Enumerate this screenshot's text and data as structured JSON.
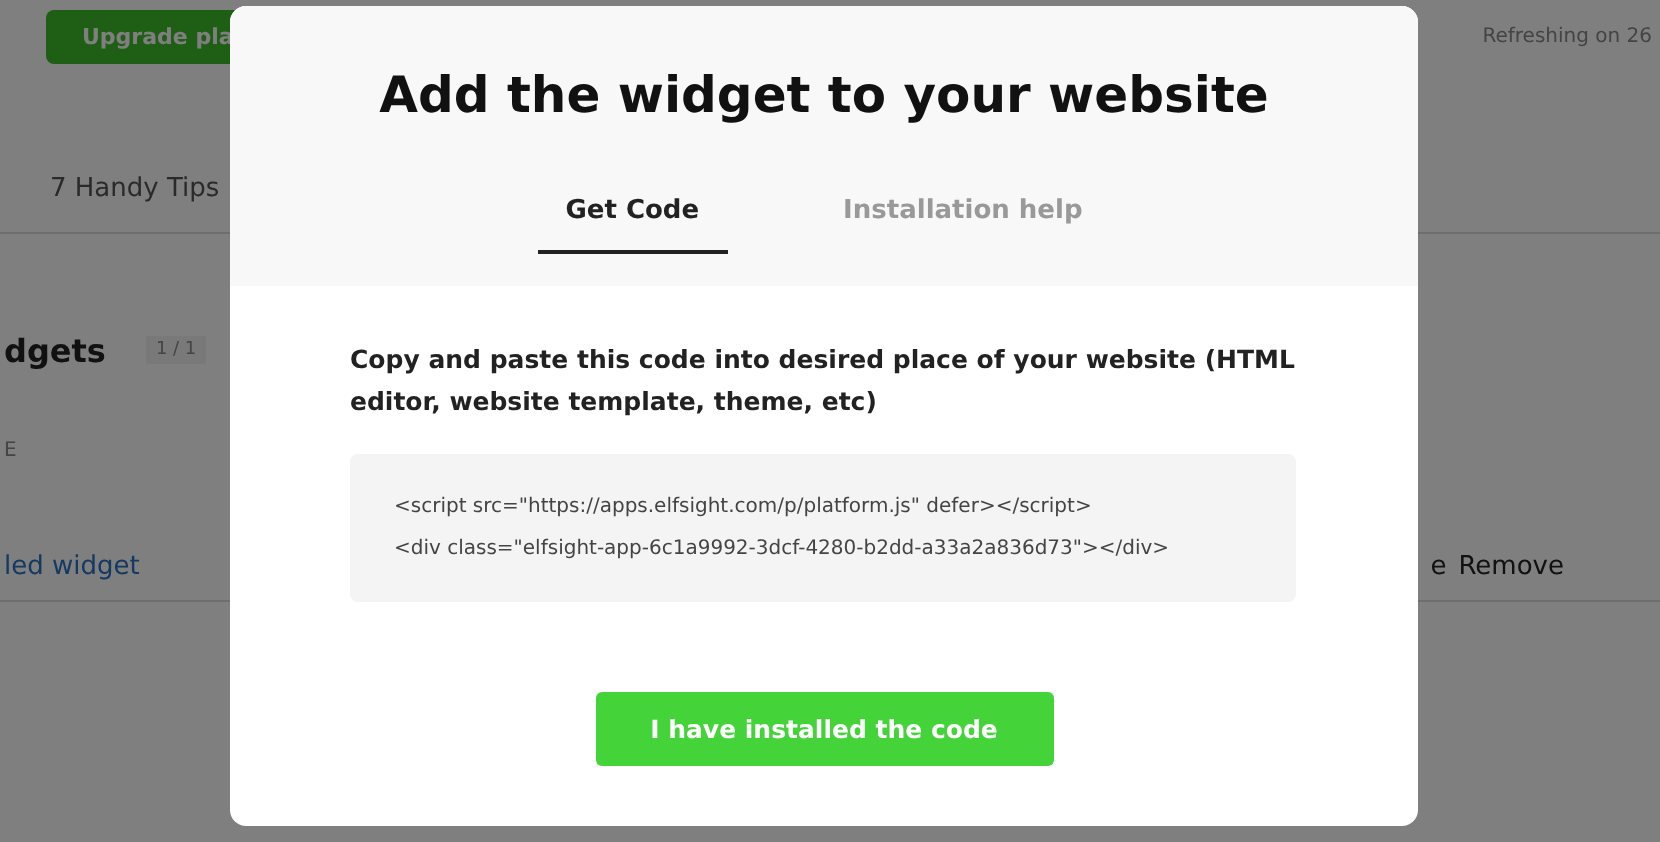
{
  "background": {
    "upgrade_button": "Upgrade pla",
    "refresh_note": "Refreshing on 26",
    "tips_link": "7 Handy Tips",
    "widgets_heading": "dgets",
    "widgets_count": "1 / 1",
    "column_header": "E",
    "widget_link": "led widget",
    "row_action_cut": "e",
    "row_action": "Remove"
  },
  "modal": {
    "title": "Add the widget to your website",
    "tabs": [
      {
        "label": "Get Code",
        "selected": true
      },
      {
        "label": "Installation help",
        "selected": false
      }
    ],
    "instructions": "Copy and paste this code into desired place of your website (HTML editor, website template, theme, etc)",
    "code_lines": [
      "<script src=\"https://apps.elfsight.com/p/platform.js\" defer></script>",
      "<div class=\"elfsight-app-6c1a9992-3dcf-4280-b2dd-a33a2a836d73\"></div>"
    ],
    "confirm_button": "I have installed the code"
  }
}
